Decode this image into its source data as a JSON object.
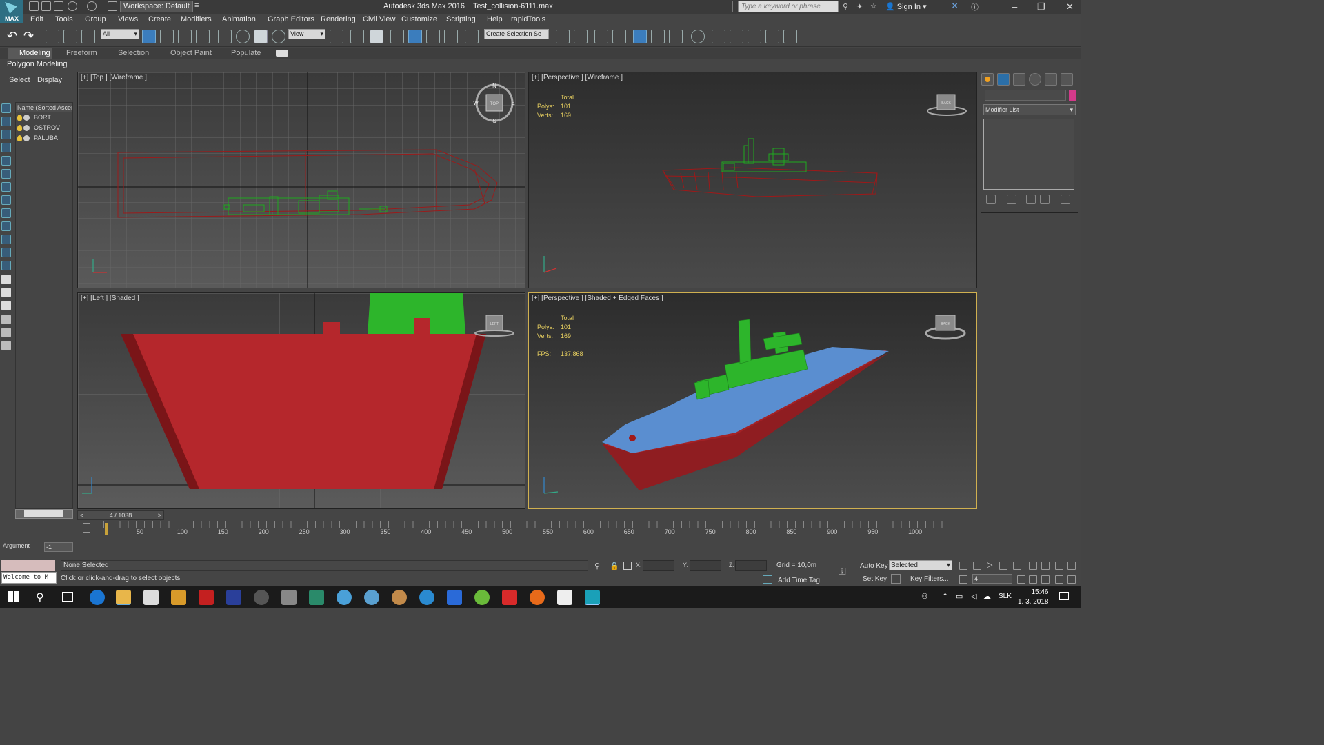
{
  "titlebar": {
    "logo": "MAX",
    "workspace": "Workspace: Default",
    "app_title": "Autodesk 3ds Max 2016    Test_collision-6111.max",
    "search_placeholder": "Type a keyword or phrase",
    "sign_in": "Sign In",
    "min": "–",
    "max": "❐",
    "close": "✕"
  },
  "menu": [
    "Edit",
    "Tools",
    "Group",
    "Views",
    "Create",
    "Modifiers",
    "Animation",
    "Graph Editors",
    "Rendering",
    "Civil View",
    "Customize",
    "Scripting",
    "Help",
    "rapidTools"
  ],
  "toolbar": {
    "filter": "All",
    "view": "View",
    "selection_set": "Create Selection Se"
  },
  "ribbon": {
    "tabs": [
      "Modeling",
      "Freeform",
      "Selection",
      "Object Paint",
      "Populate"
    ],
    "subtitle": "Polygon Modeling"
  },
  "scene": {
    "tabs": [
      "Select",
      "Display"
    ],
    "header": "Name (Sorted Ascen",
    "items": [
      "BORT",
      "OSTROV",
      "PALUBA"
    ]
  },
  "viewports": {
    "top": {
      "label": "[+] [Top ] [Wireframe ]",
      "compass": {
        "n": "N",
        "s": "S",
        "e": "E",
        "w": "W",
        "cube": "TOP"
      }
    },
    "persp1": {
      "label": "[+] [Perspective ] [Wireframe ]",
      "stats": {
        "total": "Total",
        "polys_label": "Polys:",
        "polys": "101",
        "verts_label": "Verts:",
        "verts": "169"
      },
      "cube": "BACK"
    },
    "left": {
      "label": "[+] [Left ] [Shaded ]",
      "cube": "LEFT"
    },
    "persp2": {
      "label": "[+] [Perspective ] [Shaded + Edged Faces ]",
      "stats": {
        "total": "Total",
        "polys_label": "Polys:",
        "polys": "101",
        "verts_label": "Verts:",
        "verts": "169",
        "fps_label": "FPS:",
        "fps": "137,868"
      },
      "cube": "BACK"
    }
  },
  "command_panel": {
    "modifier_list": "Modifier List"
  },
  "timeline": {
    "slider": "4 / 1038",
    "ticks": [
      "50",
      "100",
      "150",
      "200",
      "250",
      "300",
      "350",
      "400",
      "450",
      "500",
      "550",
      "600",
      "650",
      "700",
      "750",
      "800",
      "850",
      "900",
      "950",
      "1000"
    ]
  },
  "status": {
    "argument_label": "Argument",
    "argument_value": "-1",
    "selection": "None Selected",
    "prompt": "Click or click-and-drag to select objects",
    "welcome": "Welcome to M",
    "x": "X:",
    "y": "Y:",
    "z": "Z:",
    "grid": "Grid = 10,0m",
    "add_time_tag": "Add Time Tag",
    "auto_key": "Auto Key",
    "set_key": "Set Key",
    "selected": "Selected",
    "key_filters": "Key Filters...",
    "frame": "4"
  },
  "taskbar": {
    "lang": "SLK",
    "time": "15:46",
    "date": "1. 3. 2018"
  },
  "colors": {
    "hull": "#b5272c",
    "superstructure": "#2db52b",
    "deck": "#5a8ed0",
    "wire_red": "#a01818",
    "wire_green": "#1faa1f",
    "accent": "#3b7dbd"
  }
}
